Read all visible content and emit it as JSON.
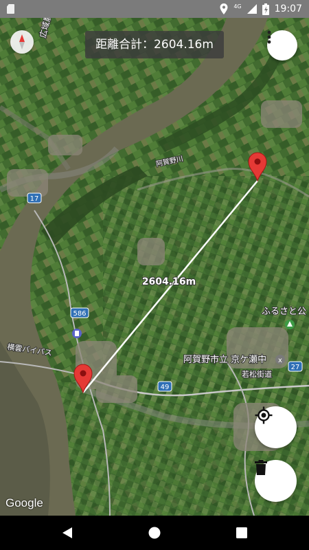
{
  "status_bar": {
    "network": "4G",
    "time": "19:07"
  },
  "map": {
    "distance_total": "距離合計：2604.16m",
    "line_label": "2604.16m",
    "place_labels": {
      "road_left_top": "広域農道",
      "river": "阿賀野川",
      "route_17": "17",
      "route_586": "586",
      "route_49": "49",
      "route_27": "27",
      "bypass": "横雲バイパス",
      "school": "阿賀野市立 京ケ瀬中",
      "wakamatsu": "若松街道",
      "furusato": "ふるさと公"
    },
    "attribution": "Google"
  },
  "buttons": {
    "menu_icon": "more-vert",
    "locate_icon": "my-location",
    "delete_icon": "trash"
  }
}
